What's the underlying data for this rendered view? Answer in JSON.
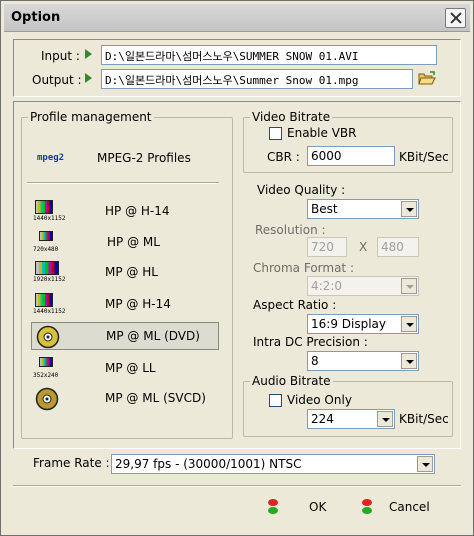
{
  "window": {
    "title": "Option"
  },
  "io": {
    "input_label": "Input :",
    "input_value": "D:\\일본드라마\\섬머스노우\\SUMMER SNOW 01.AVI",
    "output_label": "Output :",
    "output_value": "D:\\일본드라마\\섬머스노우\\Summer Snow 01.mpg"
  },
  "profile_management": {
    "title": "Profile management",
    "header_logo": "mpeg2",
    "header_label": "MPEG-2 Profiles",
    "items": [
      {
        "label": "HP @ H-14",
        "res": "1440x1152"
      },
      {
        "label": "HP @ ML",
        "res": "720x480"
      },
      {
        "label": "MP @ HL",
        "res": "1920x1152"
      },
      {
        "label": "MP @ H-14",
        "res": "1440x1152"
      },
      {
        "label": "MP @ ML (DVD)",
        "res": "",
        "selected": true
      },
      {
        "label": "MP @ LL",
        "res": "352x240"
      },
      {
        "label": "MP @ ML (SVCD)",
        "res": ""
      }
    ]
  },
  "video_bitrate": {
    "title": "Video Bitrate",
    "enable_vbr_label": "Enable VBR",
    "enable_vbr_checked": false,
    "cbr_label": "CBR :",
    "cbr_value": "6000",
    "unit": "KBit/Sec"
  },
  "video_quality": {
    "label": "Video Quality :",
    "value": "Best"
  },
  "resolution": {
    "label": "Resolution :",
    "width": "720",
    "x_label": "X",
    "height": "480"
  },
  "chroma_format": {
    "label": "Chroma Format :",
    "value": "4:2:0"
  },
  "aspect_ratio": {
    "label": "Aspect Ratio :",
    "value": "16:9 Display"
  },
  "intra_dc": {
    "label": "Intra DC Precision :",
    "value": "8"
  },
  "audio_bitrate": {
    "title": "Audio Bitrate",
    "video_only_label": "Video Only",
    "video_only_checked": false,
    "value": "224",
    "unit": "KBit/Sec"
  },
  "frame_rate": {
    "label": "Frame Rate :",
    "value": "29,97 fps - (30000/1001) NTSC"
  },
  "buttons": {
    "ok": "OK",
    "cancel": "Cancel"
  },
  "colors": {
    "arrow": "#2e8b2e",
    "window_bg": "#ece9d8"
  }
}
